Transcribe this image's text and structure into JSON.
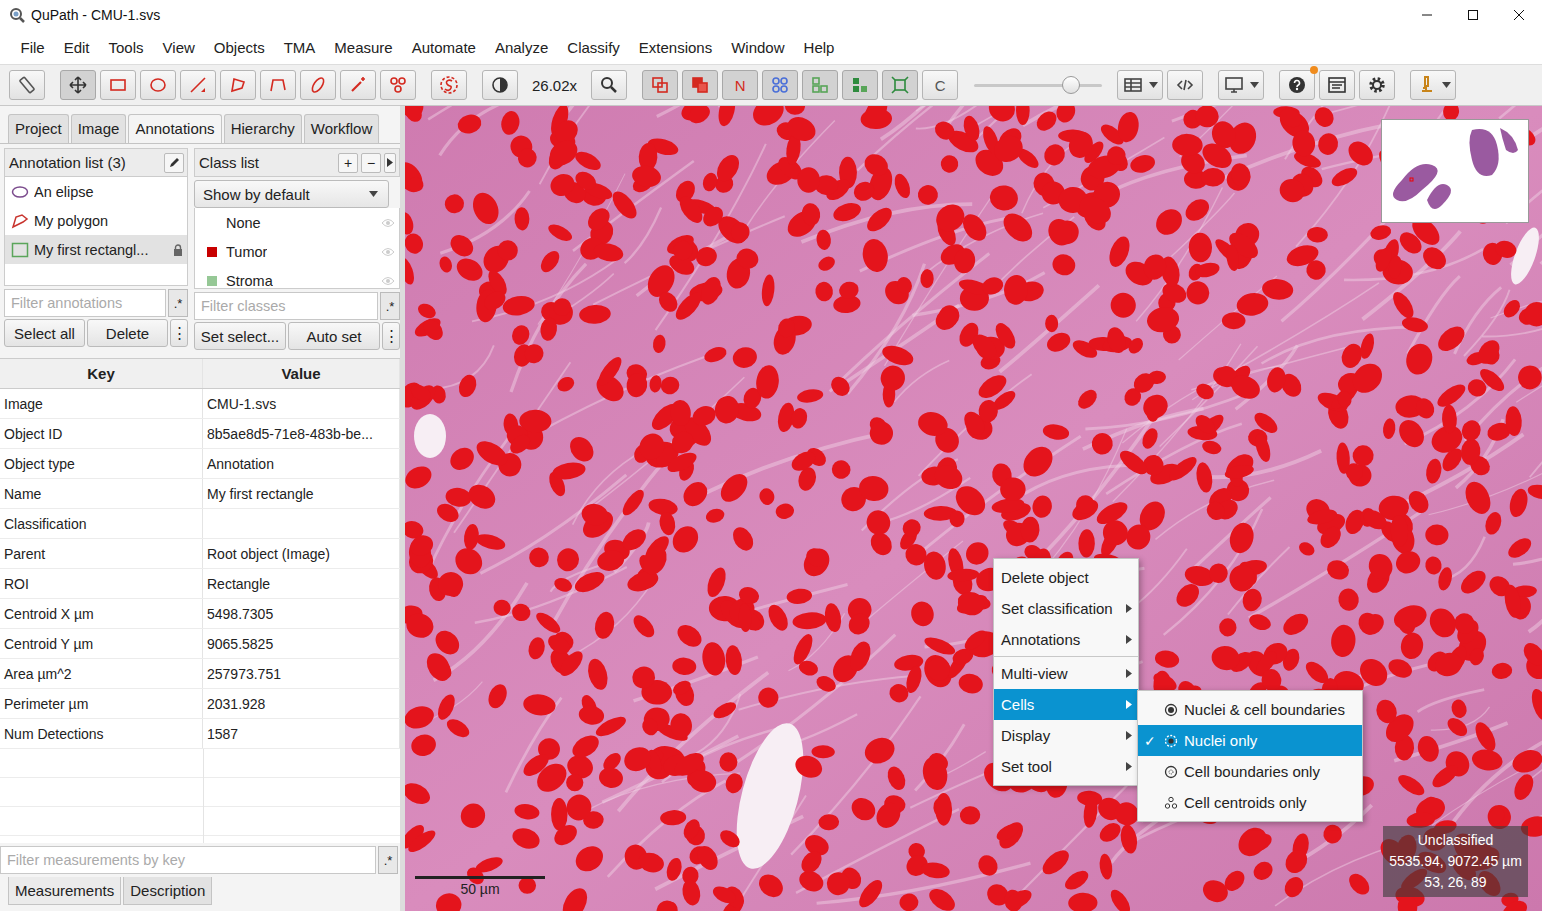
{
  "window": {
    "title": "QuPath - CMU-1.svs"
  },
  "menu": [
    "File",
    "Edit",
    "Tools",
    "View",
    "Objects",
    "TMA",
    "Measure",
    "Automate",
    "Analyze",
    "Classify",
    "Extensions",
    "Window",
    "Help"
  ],
  "toolbar": {
    "groups": [
      [
        {
          "kind": "measure-tool",
          "selected": false
        }
      ],
      [
        {
          "kind": "move",
          "selected": true
        },
        {
          "kind": "rectangle",
          "selected": false
        },
        {
          "kind": "ellipse",
          "selected": false
        },
        {
          "kind": "line",
          "selected": false
        },
        {
          "kind": "polygon",
          "selected": false
        },
        {
          "kind": "polyline",
          "selected": false
        },
        {
          "kind": "brush",
          "selected": false
        },
        {
          "kind": "wand",
          "selected": false
        },
        {
          "kind": "points",
          "selected": false
        }
      ],
      [
        {
          "kind": "selection-mode",
          "selected": false
        }
      ],
      [
        {
          "kind": "contrast",
          "selected": false
        },
        {
          "kind": "text",
          "label": "26.02x",
          "selected": false
        },
        {
          "kind": "zoom-fit",
          "selected": false
        }
      ],
      [
        {
          "kind": "show-annotations",
          "selected": true
        },
        {
          "kind": "fill-annotations",
          "selected": true
        },
        {
          "kind": "letter",
          "label": "N",
          "selected": true
        },
        {
          "kind": "tma-grid",
          "selected": true
        },
        {
          "kind": "show-detections",
          "selected": true
        },
        {
          "kind": "fill-detections",
          "selected": true
        },
        {
          "kind": "pixel-overlay",
          "selected": true
        },
        {
          "kind": "letter",
          "label": "C",
          "selected": false
        },
        {
          "kind": "slider",
          "level": 0.76
        }
      ],
      [
        {
          "kind": "table",
          "dropdown": true,
          "selected": false
        },
        {
          "kind": "script",
          "dropdown": false,
          "selected": false
        }
      ],
      [
        {
          "kind": "monitor",
          "dropdown": true,
          "selected": false
        }
      ],
      [
        {
          "kind": "help",
          "badge": true,
          "selected": false
        },
        {
          "kind": "log",
          "selected": false
        },
        {
          "kind": "settings",
          "selected": false
        }
      ],
      [
        {
          "kind": "extensions",
          "dropdown": true,
          "selected": false
        }
      ]
    ]
  },
  "left_panel": {
    "tabs": [
      {
        "label": "Project",
        "selected": false
      },
      {
        "label": "Image",
        "selected": false
      },
      {
        "label": "Annotations",
        "selected": true
      },
      {
        "label": "Hierarchy",
        "selected": false
      },
      {
        "label": "Workflow",
        "selected": false
      }
    ],
    "annotations": {
      "title": "Annotation list (3)",
      "items": [
        {
          "name": "An elipse",
          "shape": "ellipse",
          "color": "#7b4b8d",
          "selected": false,
          "locked": false
        },
        {
          "name": "My polygon",
          "shape": "polygon",
          "color": "#c8342e",
          "selected": false,
          "locked": false
        },
        {
          "name": "My first rectangl...",
          "shape": "rectangle",
          "color": "#5aa55a",
          "selected": true,
          "locked": true
        }
      ],
      "filter": {
        "placeholder": "Filter annotations",
        "regex": ".*"
      },
      "buttons": [
        "Select all",
        "Delete"
      ],
      "more": "⋮"
    },
    "classes": {
      "title": "Class list",
      "header_buttons": [
        "+",
        "−"
      ],
      "dropdown": "Show by default",
      "items": [
        {
          "name": "None"
        },
        {
          "name": "Tumor",
          "color": "#c80000"
        },
        {
          "name": "Stroma",
          "color": "#96c896"
        }
      ],
      "filter": {
        "placeholder": "Filter classes",
        "regex": ".*"
      },
      "buttons": [
        "Set select...",
        "Auto set"
      ],
      "more": "⋮"
    },
    "measurements": {
      "columns": [
        "Key",
        "Value"
      ],
      "rows": [
        [
          "Image",
          "CMU-1.svs"
        ],
        [
          "Object ID",
          "8b5ae8d5-71e8-483b-be..."
        ],
        [
          "Object type",
          "Annotation"
        ],
        [
          "Name",
          "My first rectangle"
        ],
        [
          "Classification",
          ""
        ],
        [
          "Parent",
          "Root object (Image)"
        ],
        [
          "ROI",
          "Rectangle"
        ],
        [
          "Centroid X µm",
          "5498.7305"
        ],
        [
          "Centroid Y µm",
          "9065.5825"
        ],
        [
          "Area µm^2",
          "257973.751"
        ],
        [
          "Perimeter µm",
          "2031.928"
        ],
        [
          "Num Detections",
          "1587"
        ]
      ],
      "filter": {
        "placeholder": "Filter measurements by key",
        "regex": ".*"
      }
    },
    "bottom_tabs": [
      {
        "label": "Measurements",
        "selected": true
      },
      {
        "label": "Description",
        "selected": false
      }
    ]
  },
  "viewer": {
    "scale_bar": "50 µm",
    "context_menu": [
      {
        "label": "Delete object",
        "submenu": false,
        "selected": false,
        "separator_before": false
      },
      {
        "label": "Set classification",
        "submenu": true,
        "selected": false,
        "separator_before": false
      },
      {
        "label": "Annotations",
        "submenu": true,
        "selected": false,
        "separator_before": false
      },
      {
        "label": "Multi-view",
        "submenu": true,
        "selected": false,
        "separator_before": true
      },
      {
        "label": "Cells",
        "submenu": true,
        "selected": true,
        "separator_before": false
      },
      {
        "label": "Display",
        "submenu": true,
        "selected": false,
        "separator_before": false
      },
      {
        "label": "Set tool",
        "submenu": true,
        "selected": false,
        "separator_before": false
      }
    ],
    "submenu": {
      "check": "✓",
      "items": [
        {
          "label": "Nuclei & cell boundaries",
          "kind": "both",
          "checked": false,
          "selected": false
        },
        {
          "label": "Nuclei only",
          "kind": "nuclei",
          "checked": true,
          "selected": true
        },
        {
          "label": "Cell boundaries only",
          "kind": "boundaries",
          "checked": false,
          "selected": false
        },
        {
          "label": "Cell centroids only",
          "kind": "centroids",
          "checked": false,
          "selected": false
        }
      ]
    },
    "cursor_info": [
      "Unclassified",
      "5535.94, 9072.45 µm",
      "53, 26, 89"
    ]
  }
}
